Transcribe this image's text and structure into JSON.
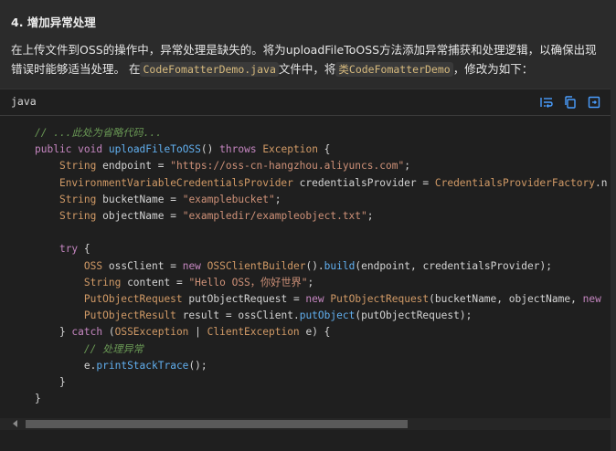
{
  "heading": "4. 增加异常处理",
  "intro": {
    "text1": "在上传文件到OSS的操作中，异常处理是缺失的。将为uploadFileToOSS方法添加异常捕获和处理逻辑，以确保出现错误时能够适当处理。 在",
    "code1": "CodeFomatterDemo.java",
    "text2": "文件中，将",
    "code2": "类CodeFomatterDemo",
    "text3": "，修改为如下："
  },
  "code_block": {
    "language": "java",
    "tools": [
      "wrap-lines-icon",
      "copy-icon",
      "expand-icon"
    ],
    "lines": [
      "// ...此处为省略代码...",
      "public void uploadFileToOSS() throws Exception {",
      "    String endpoint = \"https://oss-cn-hangzhou.aliyuncs.com\";",
      "    EnvironmentVariableCredentialsProvider credentialsProvider = CredentialsProviderFactory.n",
      "    String bucketName = \"examplebucket\";",
      "    String objectName = \"exampledir/exampleobject.txt\";",
      "",
      "    try {",
      "        OSS ossClient = new OSSClientBuilder().build(endpoint, credentialsProvider);",
      "        String content = \"Hello OSS，你好世界\";",
      "        PutObjectRequest putObjectRequest = new PutObjectRequest(bucketName, objectName, new",
      "        PutObjectResult result = ossClient.putObject(putObjectRequest);",
      "    } catch (OSSException | ClientException e) {",
      "        // 处理异常",
      "        e.printStackTrace();",
      "    }",
      "}"
    ]
  },
  "colors": {
    "background": "#2b2b2b",
    "code_background": "#1f1f1f",
    "keyword": "#c586c0",
    "type": "#d19a66",
    "string": "#ce9178",
    "function": "#61afef",
    "comment": "#6a9955",
    "tool_icon": "#4a9eff"
  }
}
